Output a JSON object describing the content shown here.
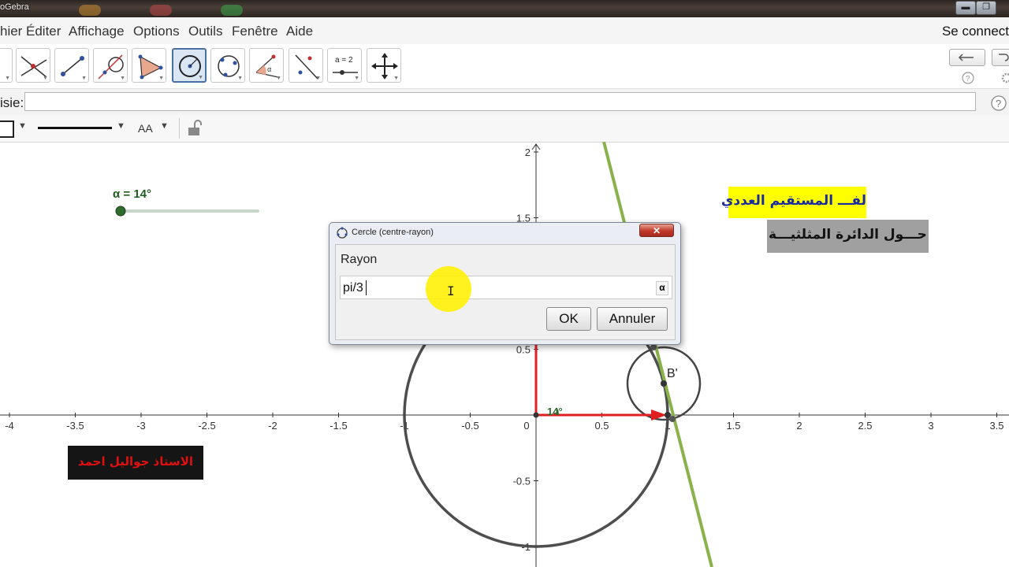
{
  "window": {
    "title": "oGebra",
    "minimize": "▬",
    "maximize": "❐"
  },
  "menu": {
    "items": [
      "hier",
      "Éditer",
      "Affichage",
      "Options",
      "Outils",
      "Fenêtre",
      "Aide"
    ],
    "connect": "Se connect"
  },
  "toolbar": {
    "tools": [
      "move",
      "point-intersect",
      "line-segment",
      "tangent",
      "polygon",
      "circle-center-radius",
      "circle-three-points",
      "angle",
      "reflect-line",
      "slider",
      "move-graphics-view"
    ],
    "slider_icon_text": "a = 2",
    "selected_tool": "circle-center-radius"
  },
  "input_bar": {
    "label": "isie:",
    "value": "",
    "help": "?"
  },
  "style_bar": {
    "text_size": "AA"
  },
  "graph": {
    "x_ticks": [
      "-4",
      "-3.5",
      "-3",
      "-2.5",
      "-2",
      "-1.5",
      "-1",
      "-0.5",
      "0",
      "0.5",
      "1",
      "1.5",
      "2",
      "2.5",
      "3",
      "3.5"
    ],
    "y_ticks": [
      "2",
      "1.5",
      "0.5",
      "-0.5",
      "-1"
    ],
    "point_label": "B'",
    "angle_label": "14°",
    "slider": {
      "label": "α = 14°",
      "value_deg": 14
    },
    "colors": {
      "circle": "#444444",
      "line": "#8ab24a",
      "vector": "#e02020",
      "slider": "#2e6b2e"
    }
  },
  "banners": {
    "yellow": "لفـــ المستقيم العددي",
    "gray": "حـــول الدائرة المثلثيـــة",
    "dark": "الاستاذ جواليل احمد"
  },
  "dialog": {
    "title": "Cercle (centre-rayon)",
    "close": "✕",
    "label": "Rayon",
    "value": "pi/3",
    "alpha_button": "α",
    "ok": "OK",
    "cancel": "Annuler"
  }
}
